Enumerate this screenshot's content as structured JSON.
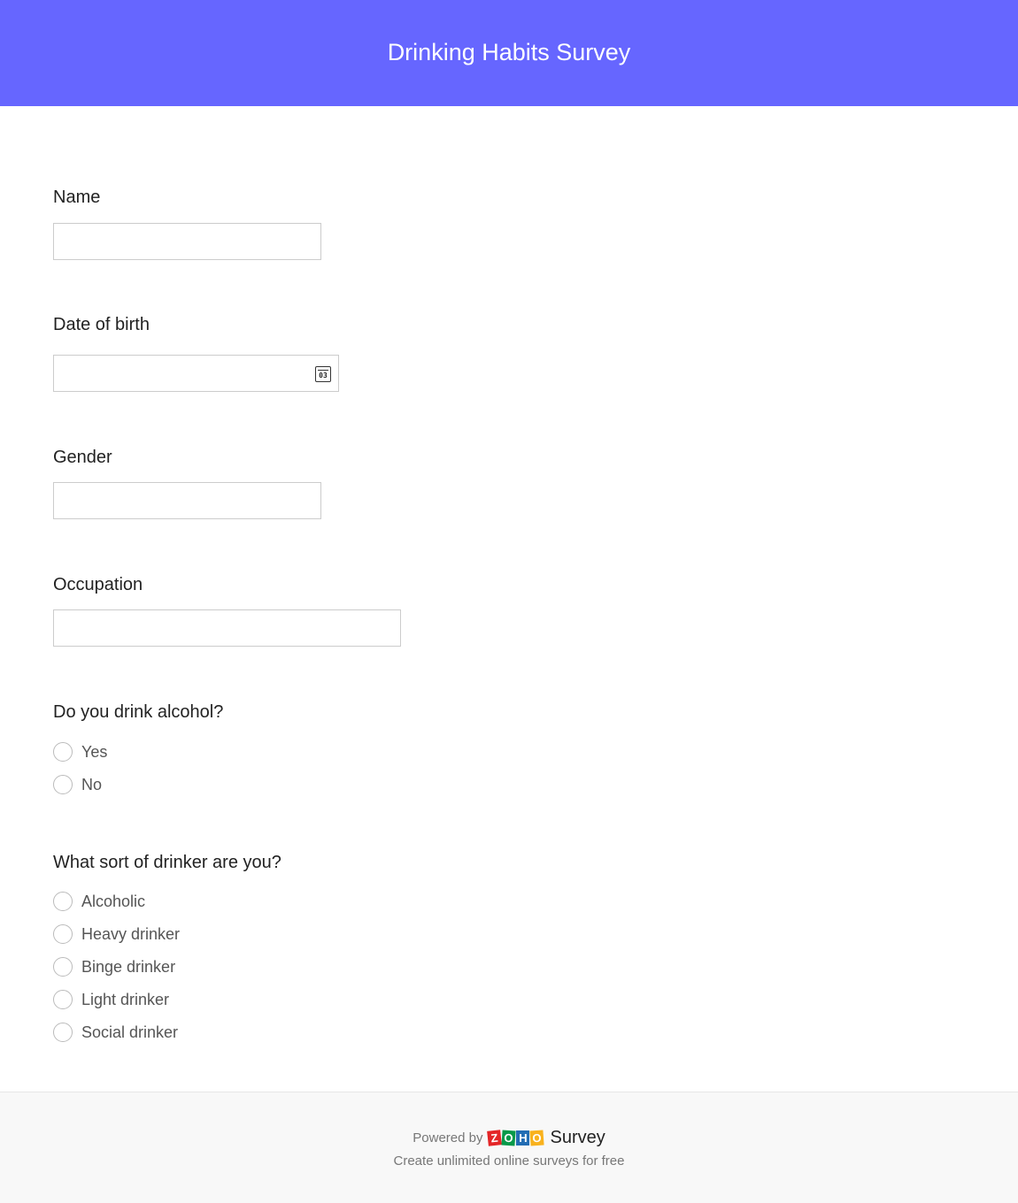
{
  "header": {
    "title": "Drinking Habits Survey",
    "color": "#6666ff"
  },
  "fields": [
    {
      "label": "Name",
      "value": ""
    },
    {
      "label": "Date of birth",
      "value": "",
      "icon": "calendar-icon",
      "icon_text": "03"
    },
    {
      "label": "Gender",
      "value": ""
    },
    {
      "label": "Occupation",
      "value": ""
    }
  ],
  "q_drink": {
    "label": "Do you drink alcohol?",
    "options": [
      "Yes",
      "No"
    ]
  },
  "q_type": {
    "label": "What sort of drinker are you?",
    "options": [
      "Alcoholic",
      "Heavy drinker",
      "Binge drinker",
      "Light drinker",
      "Social drinker"
    ]
  },
  "footer": {
    "powered_by": "Powered by",
    "logo": "ZOHO",
    "product": "Survey",
    "tagline": "Create unlimited online surveys for free"
  }
}
